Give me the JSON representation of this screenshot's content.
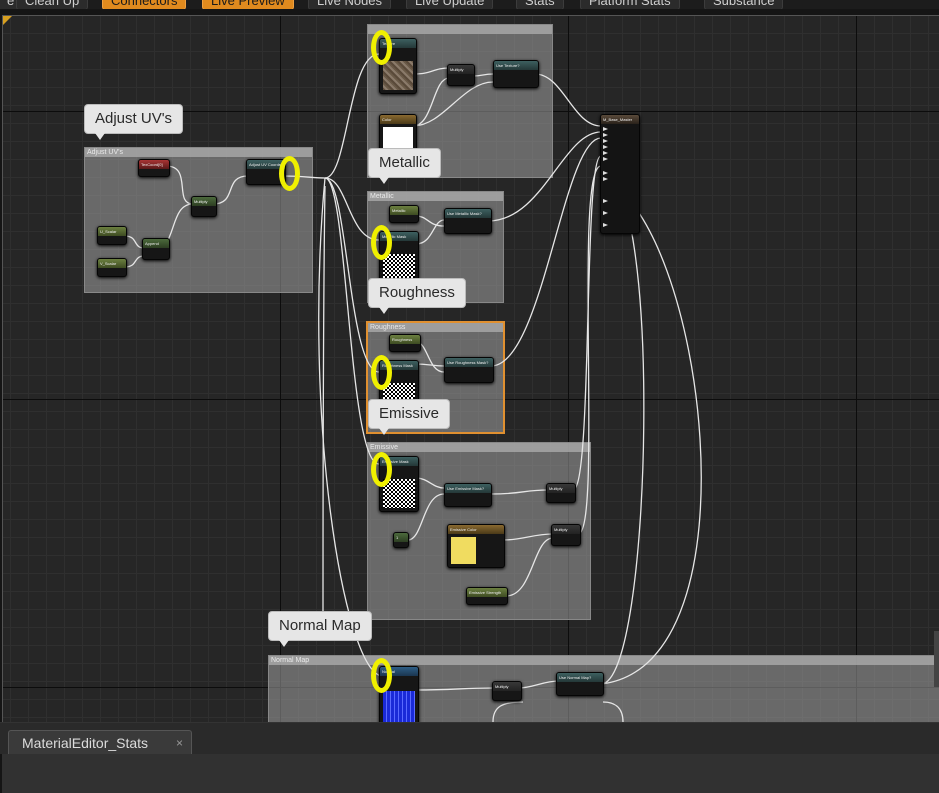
{
  "toolbar": {
    "items": [
      {
        "label": "e",
        "active": false
      },
      {
        "label": "Clean Up",
        "active": false
      },
      {
        "label": "Connectors",
        "active": true
      },
      {
        "label": "Live Preview",
        "active": true
      },
      {
        "label": "Live Nodes",
        "active": false
      },
      {
        "label": "Live Update",
        "active": false
      },
      {
        "label": "Stats",
        "active": false
      },
      {
        "label": "Platform Stats",
        "active": false
      },
      {
        "label": "Substance",
        "active": false
      }
    ]
  },
  "comments": {
    "adjust_uvs": {
      "bubble": "Adjust UV's",
      "header": "Adjust UV's"
    },
    "base_color": {
      "header": ""
    },
    "metallic": {
      "bubble": "Metallic",
      "header": "Metallic"
    },
    "roughness": {
      "bubble": "Roughness",
      "header": "Roughness"
    },
    "emissive": {
      "bubble": "Emissive",
      "header": "Emissive"
    },
    "normal_map": {
      "bubble": "Normal Map",
      "header": "Normal Map"
    }
  },
  "nodes": {
    "tex_coord": "TexCoord[0]",
    "uv_scalar_1": "U_Scalar",
    "uv_scalar_2": "V_Scalar",
    "append": "Append",
    "multiply_uv": "Multiply",
    "adjust_uv_coords": "Adjust UV Coords",
    "base_texture_sample": "Texture",
    "multiply_base": "Multiply",
    "use_texture": "Use Texture?",
    "color_param": "Color",
    "metallic_param": "Metallic",
    "metallic_mask": "Metallic Mask",
    "use_metallic_mask": "Use Metallic Mask?",
    "roughness_param": "Roughness",
    "roughness_mask": "Roughness Mask",
    "use_roughness_mask": "Use Roughness Mask?",
    "emissive_mask": "Emissive Mask",
    "use_emissive_mask": "Use Emissive Mask?",
    "emissive_const": "1",
    "emissive_color": "Emissive Color",
    "emissive_strength": "Emissive Strength",
    "multiply_emissive_1": "Multiply",
    "multiply_emissive_2": "Multiply",
    "normal_texture": "Normal",
    "multiply_normal": "Multiply",
    "use_normal_map": "Use Normal Map?",
    "material_result": "M_Base_Master"
  },
  "bottom": {
    "tab_label": "MaterialEditor_Stats",
    "tab_close": "×"
  },
  "colors": {
    "highlight_ring": "#f0f000",
    "selected_comment": "#e09030",
    "active_toolbar": "#e08a1e"
  }
}
